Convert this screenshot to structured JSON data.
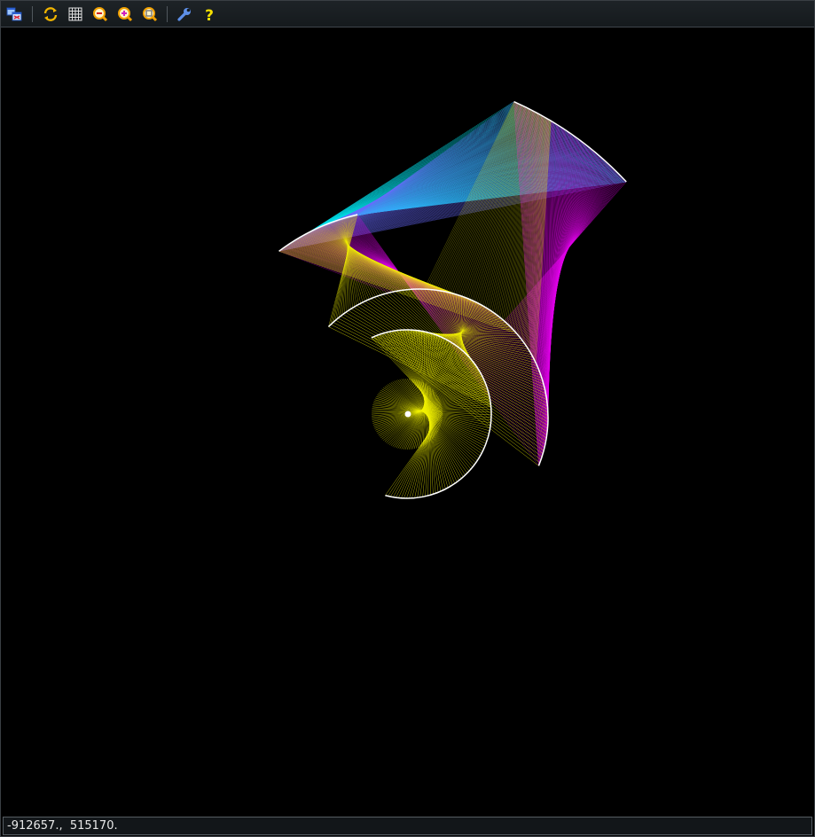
{
  "toolbar": {
    "buttons": [
      {
        "name": "open-file-button",
        "icon": "open-windows-icon"
      },
      {
        "name": "refresh-button",
        "icon": "refresh-icon"
      },
      {
        "name": "grid-toggle-button",
        "icon": "grid-icon"
      },
      {
        "name": "zoom-in-button",
        "icon": "zoom-in-icon"
      },
      {
        "name": "zoom-out-button",
        "icon": "zoom-out-icon"
      },
      {
        "name": "zoom-fit-button",
        "icon": "zoom-fit-icon"
      },
      {
        "name": "settings-button",
        "icon": "wrench-icon"
      },
      {
        "name": "help-button",
        "icon": "question-icon"
      }
    ]
  },
  "colors": {
    "background": "#000000",
    "cyan": "#00e5f0",
    "blue": "#6a6cff",
    "magenta": "#e000e8",
    "yellow": "#f2f200",
    "arc": "#ffffff"
  },
  "status": {
    "coordinates": "-912657.,  515170."
  }
}
